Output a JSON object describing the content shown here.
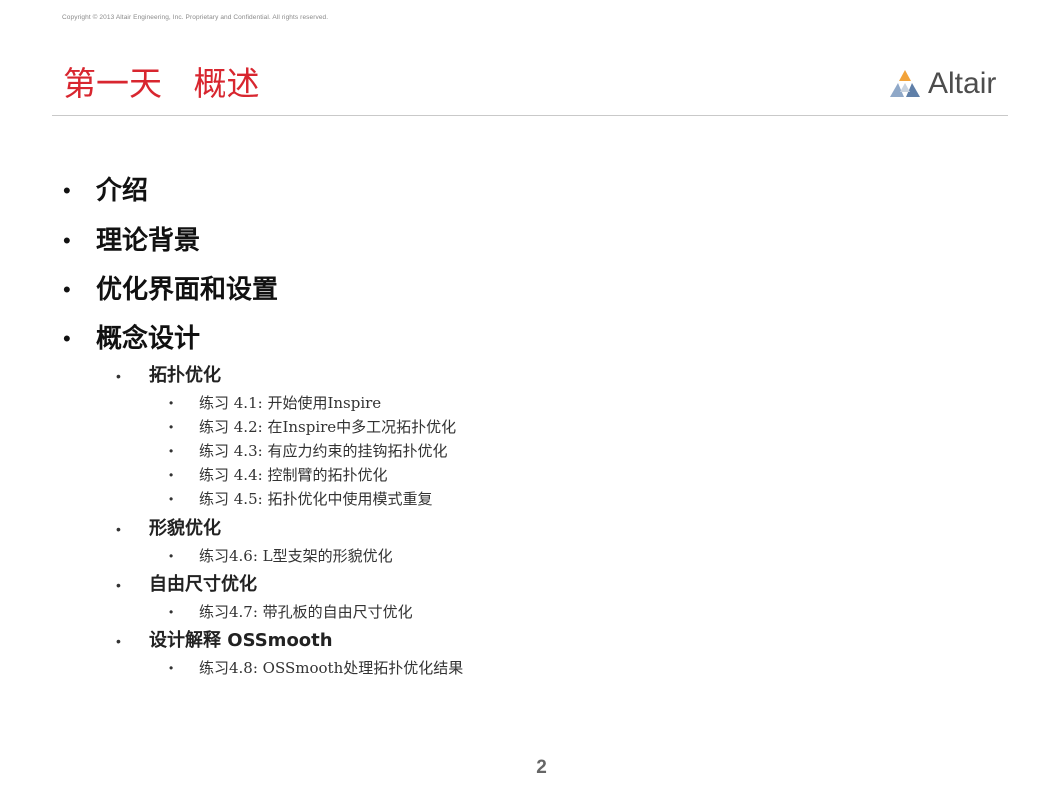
{
  "header": {
    "copyright": "Copyright © 2013 Altair Engineering, Inc. Proprietary and Confidential. All rights reserved.",
    "title": "第一天   概述",
    "logo_text": "Altair"
  },
  "outline": {
    "items": [
      "介绍",
      "理论背景",
      "优化界面和设置",
      "概念设计"
    ],
    "concept_design": [
      {
        "label": "拓扑优化",
        "exercises": [
          "练习 4.1: 开始使用Inspire",
          "练习 4.2: 在Inspire中多工况拓扑优化",
          "练习 4.3: 有应力约束的挂钩拓扑优化",
          "练习 4.4: 控制臂的拓扑优化",
          "练习 4.5: 拓扑优化中使用模式重复"
        ]
      },
      {
        "label": "形貌优化",
        "exercises": [
          "练习4.6: L型支架的形貌优化"
        ]
      },
      {
        "label": "自由尺寸优化",
        "exercises": [
          "练习4.7:  带孔板的自由尺寸优化"
        ]
      },
      {
        "label": "设计解释 OSSmooth",
        "exercises": [
          "练习4.8:  OSSmooth处理拓扑优化结果"
        ]
      }
    ]
  },
  "footer": {
    "page_number": "2"
  },
  "colors": {
    "title": "#d8262f",
    "rule": "#c9c9c9",
    "logo_text": "#4d4d4d"
  }
}
